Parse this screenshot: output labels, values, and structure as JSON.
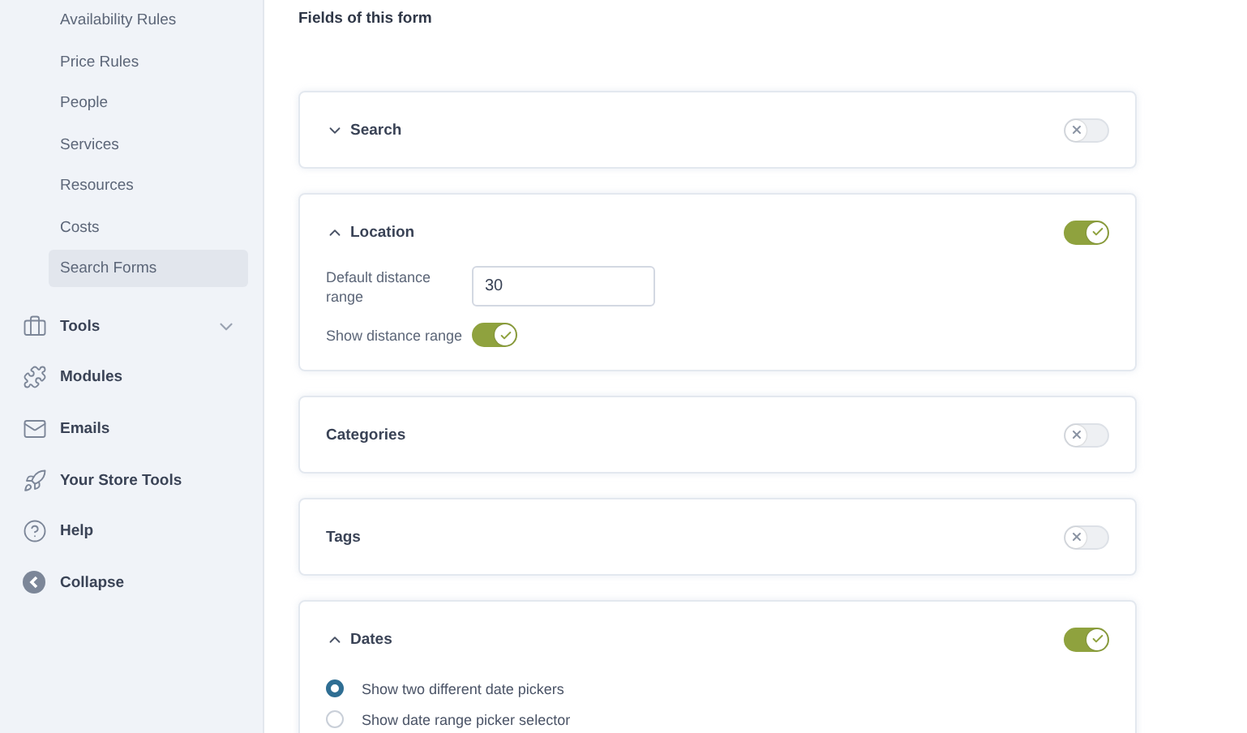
{
  "sidebar": {
    "sub_items": [
      {
        "label": "Availability Rules",
        "selected": false
      },
      {
        "label": "Price Rules",
        "selected": false
      },
      {
        "label": "People",
        "selected": false
      },
      {
        "label": "Services",
        "selected": false
      },
      {
        "label": "Resources",
        "selected": false
      },
      {
        "label": "Costs",
        "selected": false
      },
      {
        "label": "Search Forms",
        "selected": true
      }
    ],
    "items": [
      {
        "label": "Tools",
        "expanded": false
      },
      {
        "label": "Modules"
      },
      {
        "label": "Emails"
      },
      {
        "label": "Your Store Tools"
      },
      {
        "label": "Help"
      },
      {
        "label": "Collapse"
      }
    ]
  },
  "main": {
    "title": "Fields of this form",
    "fields": [
      {
        "title": "Search",
        "expanded": false,
        "on": false
      },
      {
        "title": "Location",
        "expanded": true,
        "on": true,
        "settings": [
          {
            "kind": "input",
            "label": "Default distance range",
            "value": "30"
          },
          {
            "kind": "toggle",
            "label": "Show distance range",
            "on": true
          }
        ]
      },
      {
        "title": "Categories",
        "on": false
      },
      {
        "title": "Tags",
        "on": false
      },
      {
        "title": "Dates",
        "expanded": true,
        "on": true,
        "settings": [
          {
            "kind": "radio",
            "label": "Show two different date pickers",
            "selected": true
          },
          {
            "kind": "radio",
            "label": "Show date range picker selector",
            "selected": false
          }
        ]
      }
    ]
  }
}
